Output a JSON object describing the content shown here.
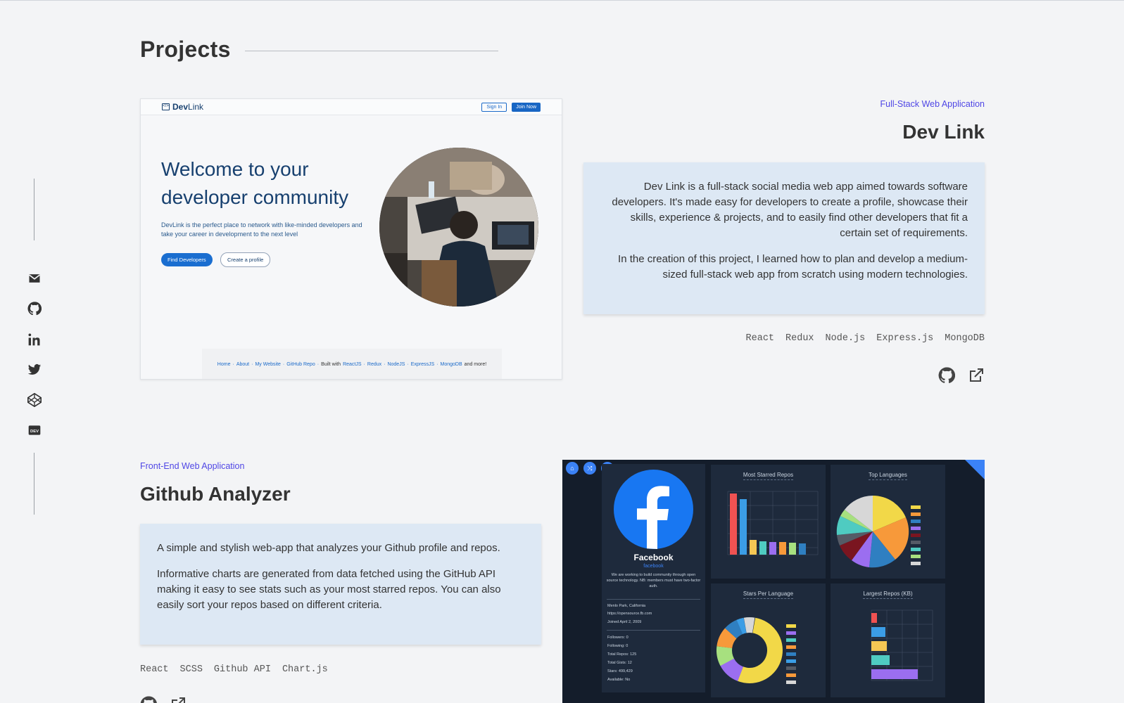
{
  "section": {
    "title": "Projects"
  },
  "social": {
    "email_label": "Email",
    "github_label": "GitHub",
    "linkedin_label": "LinkedIn",
    "twitter_label": "Twitter",
    "codepen_label": "CodePen",
    "dev_label": "DEV"
  },
  "project1": {
    "type": "Full-Stack Web Application",
    "title": "Dev Link",
    "description": [
      "Dev Link is a full-stack social media web app aimed towards software developers. It's made easy for developers to create a profile, showcase their skills, experience & projects, and to easily find other developers that fit a certain set of requirements.",
      "In the creation of this project, I learned how to plan and develop a medium-sized full-stack web app from scratch using modern technologies."
    ],
    "tech": [
      "React",
      "Redux",
      "Node.js",
      "Express.js",
      "MongoDB"
    ],
    "screenshot": {
      "logo_bold": "Dev",
      "logo_rest": "Link",
      "sign_in": "Sign In",
      "join_now": "Join Now",
      "headline": "Welcome to your developer community",
      "subtext": "DevLink is the perfect place to network with like-minded developers and take your career in development to the next level",
      "btn_find": "Find Developers",
      "btn_create": "Create a profile",
      "footer_links": [
        "Home",
        "About",
        "My Website",
        "GitHub Repo"
      ],
      "footer_built": "Built with",
      "footer_tech": [
        "ReactJS",
        "Redux",
        "NodeJS",
        "ExpressJS",
        "MongoDB"
      ],
      "footer_more": "and more!"
    }
  },
  "project2": {
    "type": "Front-End Web Application",
    "title": "Github Analyzer",
    "description": [
      "A simple and stylish web-app that analyzes your Github profile and repos.",
      "Informative charts are generated from data fetched using the GitHub API making it easy to see stats such as your most starred repos. You can also easily sort your repos based on different criteria."
    ],
    "tech": [
      "React",
      "SCSS",
      "Github API",
      "Chart.js"
    ],
    "screenshot": {
      "profile_name": "Facebook",
      "profile_handle": "facebook",
      "profile_bio": "We are working to build community through open source technology. NB: members must have two-factor auth.",
      "location": "Menlo Park, California",
      "website": "https://opensource.fb.com",
      "joined": "Joined April 2, 2009",
      "followers": "Followers: 0",
      "following": "Following: 0",
      "repos": "Total Repos: 125",
      "gists": "Total Gists: 12",
      "stars": "Stars: 499,429",
      "available": "Available: No",
      "chart1_title": "Most Starred Repos",
      "chart2_title": "Top Languages",
      "chart3_title": "Stars Per Language",
      "chart4_title": "Largest Repos (KB)"
    }
  },
  "colors": {
    "accent": "#4f46e5",
    "card_bg": "#dde8f4",
    "page_bg": "#f3f4f6",
    "gh_bg": "#141d2b"
  }
}
